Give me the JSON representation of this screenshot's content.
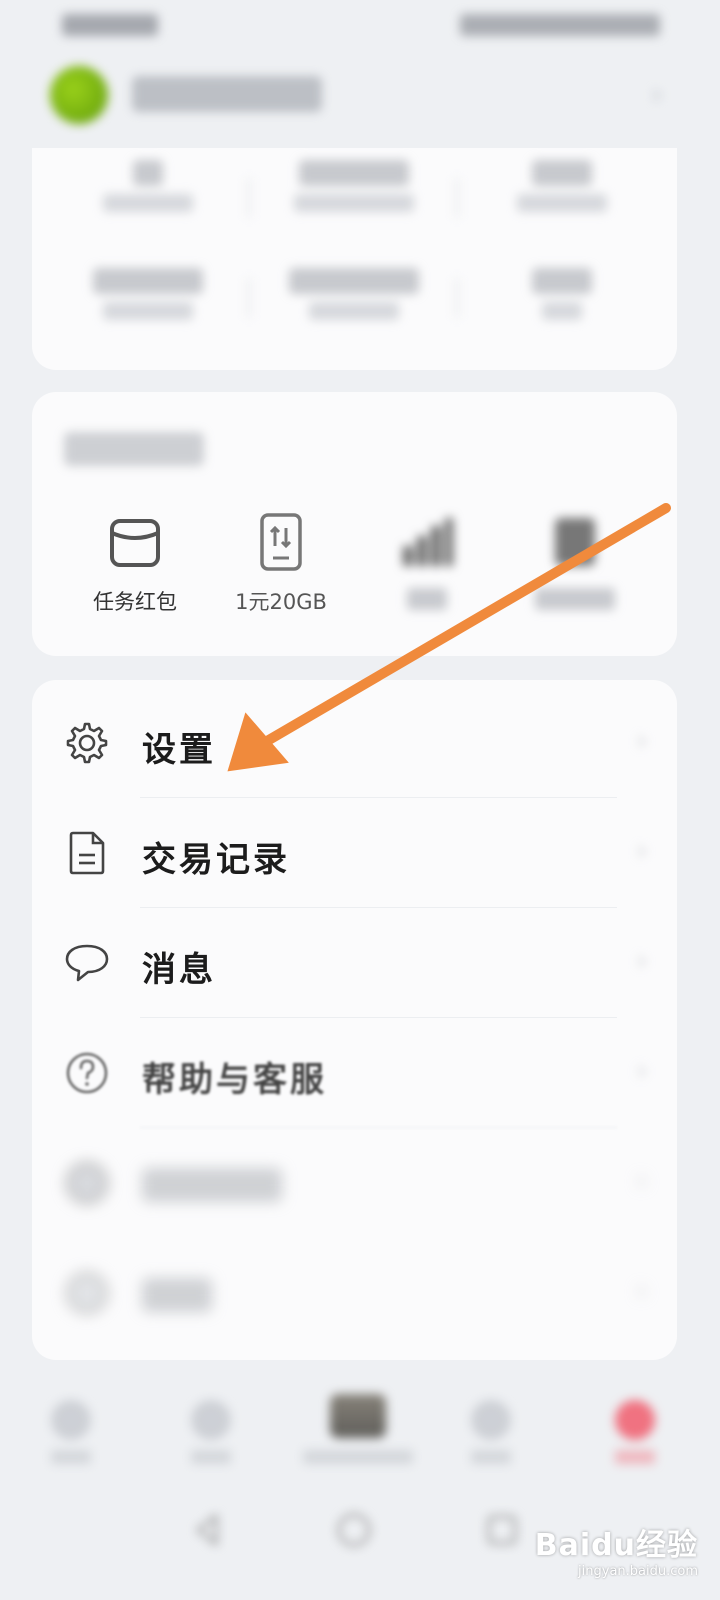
{
  "services": {
    "items": [
      {
        "label": "任务红包",
        "icon": "wallet-icon"
      },
      {
        "label": "1元20GB",
        "icon": "sim-data-icon"
      }
    ]
  },
  "menu": {
    "items": [
      {
        "label": "设置",
        "icon": "gear-icon"
      },
      {
        "label": "交易记录",
        "icon": "document-icon"
      },
      {
        "label": "消息",
        "icon": "chat-bubble-icon"
      },
      {
        "label": "帮助与客服",
        "icon": "help-icon"
      }
    ]
  },
  "watermark": {
    "main": "Baidu经验",
    "sub": "jingyan.baidu.com"
  },
  "colors": {
    "arrow": "#f08a3c",
    "avatar": "#7fb816",
    "nav_active": "#f05c6c"
  }
}
